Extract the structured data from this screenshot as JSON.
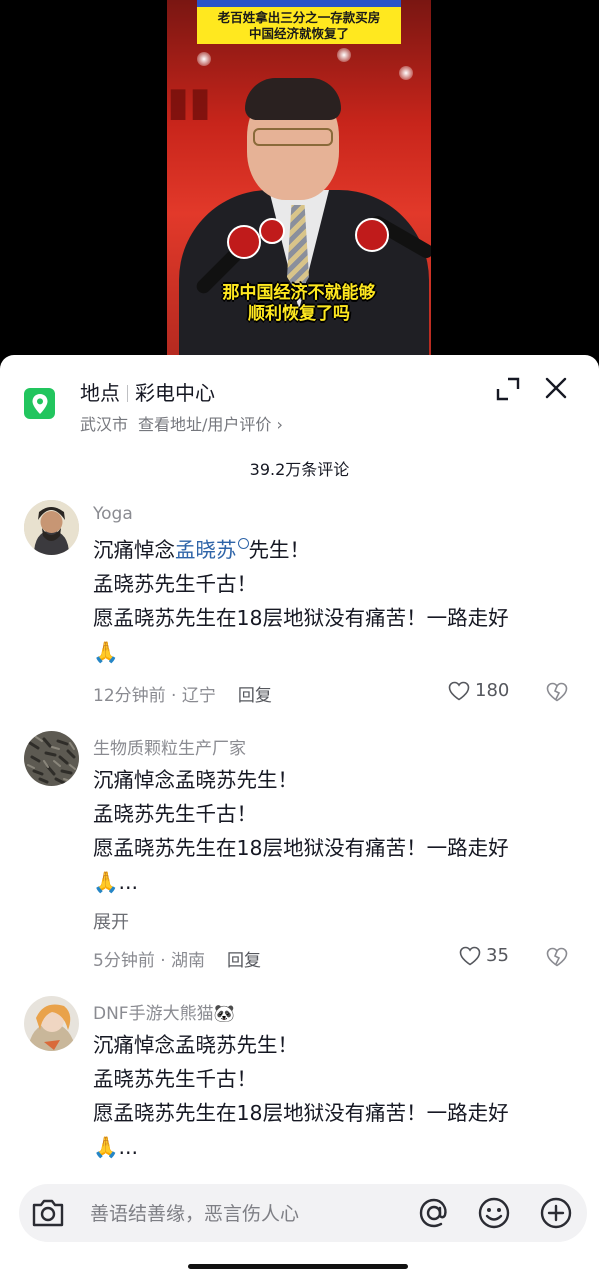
{
  "video": {
    "banner_line1": "老百姓拿出三分之一存款买房",
    "banner_line2": "中国经济就恢复了",
    "subtitle_line1": "那中国经济不就能够",
    "subtitle_line2": "顺利恢复了吗"
  },
  "location": {
    "label": "地点",
    "name": "彩电中心",
    "city": "武汉市",
    "link_text": "查看地址/用户评价 ›"
  },
  "comments_count": "39.2万条评论",
  "comments": [
    {
      "username": "Yoga",
      "line1_pre": "沉痛悼念",
      "line1_link": "孟晓苏",
      "line1_post": "先生！",
      "line2": "孟晓苏先生千古！",
      "line3": "愿孟晓苏先生在18层地狱没有痛苦！一路走好",
      "line4": "🙏",
      "time": "12分钟前",
      "region": "辽宁",
      "reply": "回复",
      "likes": "180"
    },
    {
      "username": "生物质颗粒生产厂家",
      "line1": "沉痛悼念孟晓苏先生！",
      "line2": "孟晓苏先生千古！",
      "line3": "愿孟晓苏先生在18层地狱没有痛苦！一路走好",
      "line4": "🙏...",
      "expand": "展开",
      "time": "5分钟前",
      "region": "湖南",
      "reply": "回复",
      "likes": "35"
    },
    {
      "username": "DNF手游大熊猫🐼",
      "line1": "沉痛悼念孟晓苏先生！",
      "line2": "孟晓苏先生千古！",
      "line3": "愿孟晓苏先生在18层地狱没有痛苦！一路走好",
      "line4": "🙏..."
    }
  ],
  "input": {
    "placeholder": "善语结善缘，恶言伤人心"
  },
  "colors": {
    "accent_link": "#2e64a8",
    "location_icon": "#22c55e",
    "subtitle": "#ffe81f"
  }
}
